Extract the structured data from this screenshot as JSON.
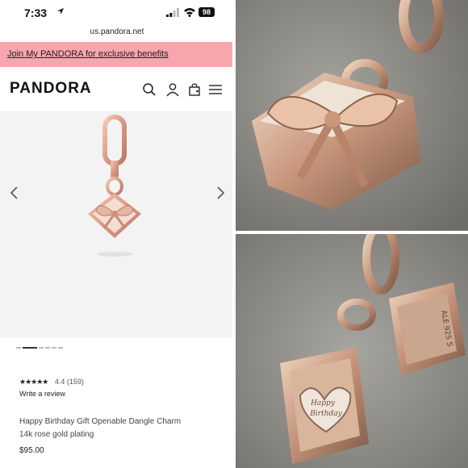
{
  "status_bar": {
    "time": "7:33",
    "battery": "98"
  },
  "browser": {
    "url": "us.pandora.net"
  },
  "promo": {
    "text": "Join My PANDORA for exclusive benefits"
  },
  "header": {
    "logo": "PANDORA"
  },
  "product": {
    "rating_value": "4.4",
    "rating_count": "(159)",
    "stars": "★★★★★",
    "write_review": "Write a review",
    "title_line1": "Happy Birthday Gift Openable Dangle Charm",
    "title_line2": "14k rose gold plating",
    "price": "$95.00"
  },
  "photos": {
    "top_caption": "",
    "bottom_heart_text_line1": "Happy",
    "bottom_heart_text_line2": "Birthday",
    "bottom_engraving": "ALE 925 S"
  },
  "colors": {
    "promo_bg": "#f7a6ad",
    "rose_gold": "#d9a48f",
    "photo_bg_top": "#8a8a85",
    "photo_bg_bottom": "#8e8d86"
  }
}
